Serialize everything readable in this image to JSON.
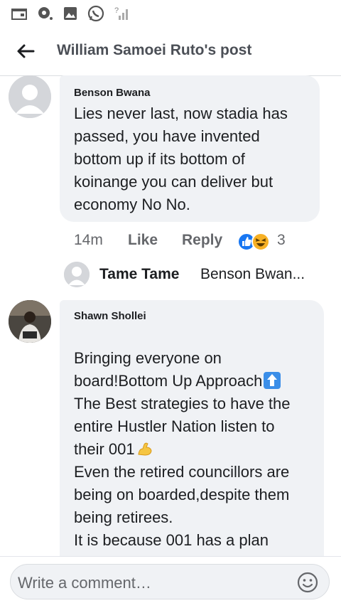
{
  "status_bar": {
    "icons": [
      "calendar-icon",
      "chat-bubble-icon",
      "gallery-icon",
      "whatsapp-icon",
      "no-signal-icon"
    ]
  },
  "header": {
    "title": "William Samoei Ruto's post",
    "back_icon": "arrow-left-icon"
  },
  "comments": [
    {
      "author": "Benson Bwana",
      "lines": [
        "Lies never last, now stadia has",
        "passed, you have invented",
        "bottom up if its bottom of",
        "koinange you can deliver but",
        "economy No No."
      ],
      "time": "14m",
      "like_label": "Like",
      "reply_label": "Reply",
      "reactions": [
        "like-reaction-icon",
        "haha-reaction-icon"
      ],
      "reaction_count": "3",
      "reply_preview": {
        "name": "Tame Tame",
        "text": "Benson Bwan..."
      }
    },
    {
      "author": "Shawn Shollei",
      "lines": [
        "Bringing everyone on",
        "board!Bottom Up Approach",
        "The Best strategies to have the",
        "entire Hustler Nation listen to",
        "their 001",
        "Even the retired councillors are",
        "being on boarded,despite them",
        "being retirees.",
        "It is because 001 has a plan"
      ]
    }
  ],
  "composer": {
    "placeholder": "Write a comment…",
    "emoji_icon": "smiley-icon"
  },
  "colors": {
    "bubble": "#f0f2f5",
    "meta_text": "#65676b",
    "like_blue": "#1877f2"
  }
}
